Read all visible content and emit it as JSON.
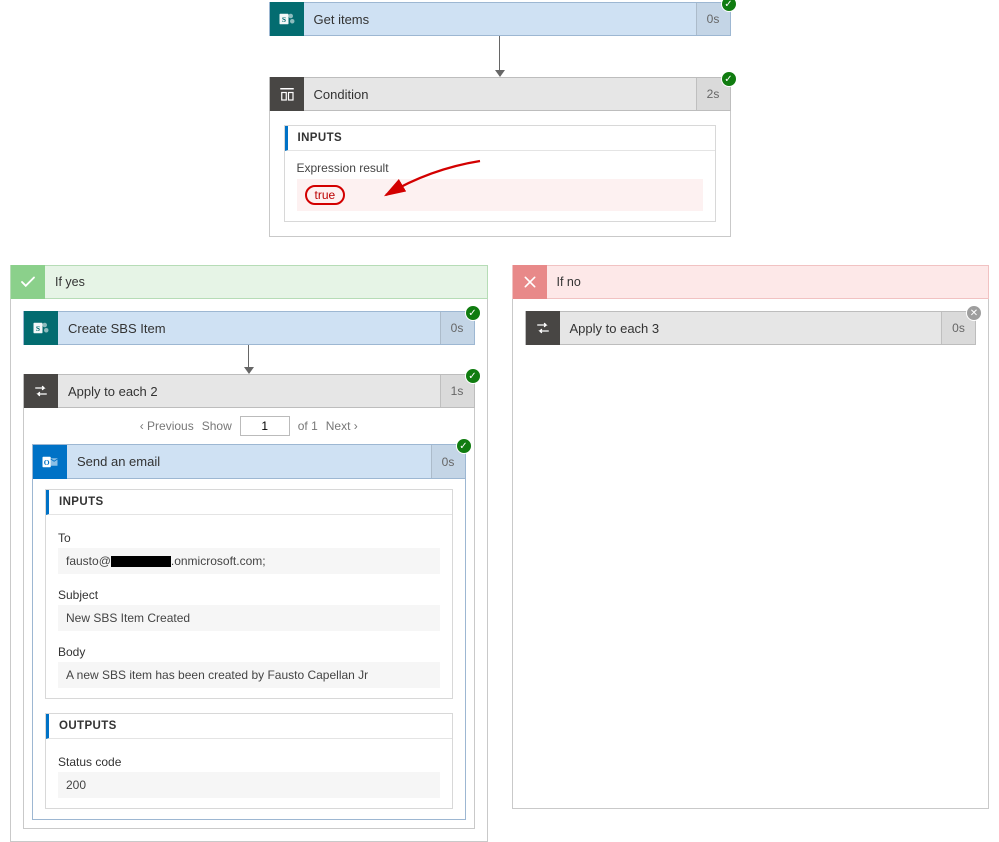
{
  "top": {
    "getItems": {
      "label": "Get items",
      "duration": "0s",
      "status": "success"
    },
    "condition": {
      "label": "Condition",
      "duration": "2s",
      "status": "success"
    },
    "inputsHeader": "INPUTS",
    "expressionResultLabel": "Expression result",
    "expressionResultValue": "true"
  },
  "branches": {
    "yes": {
      "title": "If yes",
      "createSbs": {
        "label": "Create SBS Item",
        "duration": "0s",
        "status": "success"
      },
      "applyEach2": {
        "label": "Apply to each 2",
        "duration": "1s",
        "status": "success"
      },
      "pager": {
        "prev": "Previous",
        "showLabel": "Show",
        "page": "1",
        "ofLabel": "of 1",
        "next": "Next"
      },
      "sendEmail": {
        "label": "Send an email",
        "duration": "0s",
        "status": "success",
        "inputsHeader": "INPUTS",
        "toLabel": "To",
        "toPrefix": "fausto@",
        "toSuffix": ".onmicrosoft.com;",
        "subjectLabel": "Subject",
        "subjectValue": "New SBS Item Created",
        "bodyLabel": "Body",
        "bodyValue": "A new SBS item has been created by Fausto Capellan Jr",
        "outputsHeader": "OUTPUTS",
        "statusCodeLabel": "Status code",
        "statusCodeValue": "200"
      }
    },
    "no": {
      "title": "If no",
      "applyEach3": {
        "label": "Apply to each 3",
        "duration": "0s",
        "status": "cancelled"
      }
    }
  }
}
